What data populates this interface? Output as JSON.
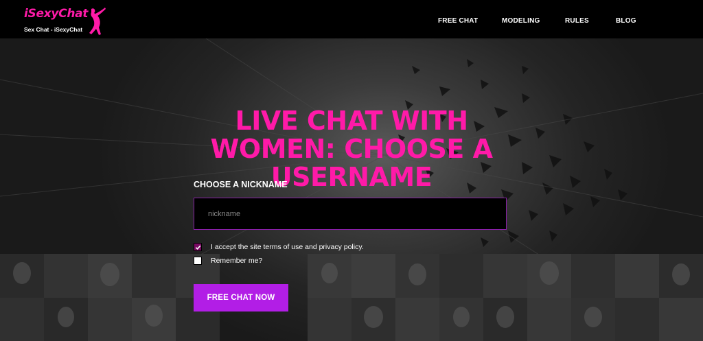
{
  "brand": {
    "logo_text": "iSexyChat",
    "tagline": "Sex Chat - iSexyChat",
    "color": "#ff1aa8"
  },
  "nav": {
    "items": [
      {
        "label": "FREE CHAT"
      },
      {
        "label": "MODELING"
      },
      {
        "label": "RULES"
      },
      {
        "label": "BLOG"
      }
    ]
  },
  "hero": {
    "headline": "LIVE CHAT WITH WOMEN: CHOOSE A USERNAME",
    "headline_color": "#ff1aa8"
  },
  "form": {
    "nickname_label": "CHOOSE A NICKNAME",
    "nickname_placeholder": "nickname",
    "nickname_value": "",
    "terms_label": "I accept the site terms of use and privacy policy.",
    "terms_checked": true,
    "remember_label": "Remember me?",
    "remember_checked": false,
    "submit_label": "FREE CHAT NOW",
    "accent_color": "#b21ee6"
  },
  "icons": {
    "logo_figure": "dancer-silhouette-icon",
    "checkmark": "checkmark-icon"
  }
}
